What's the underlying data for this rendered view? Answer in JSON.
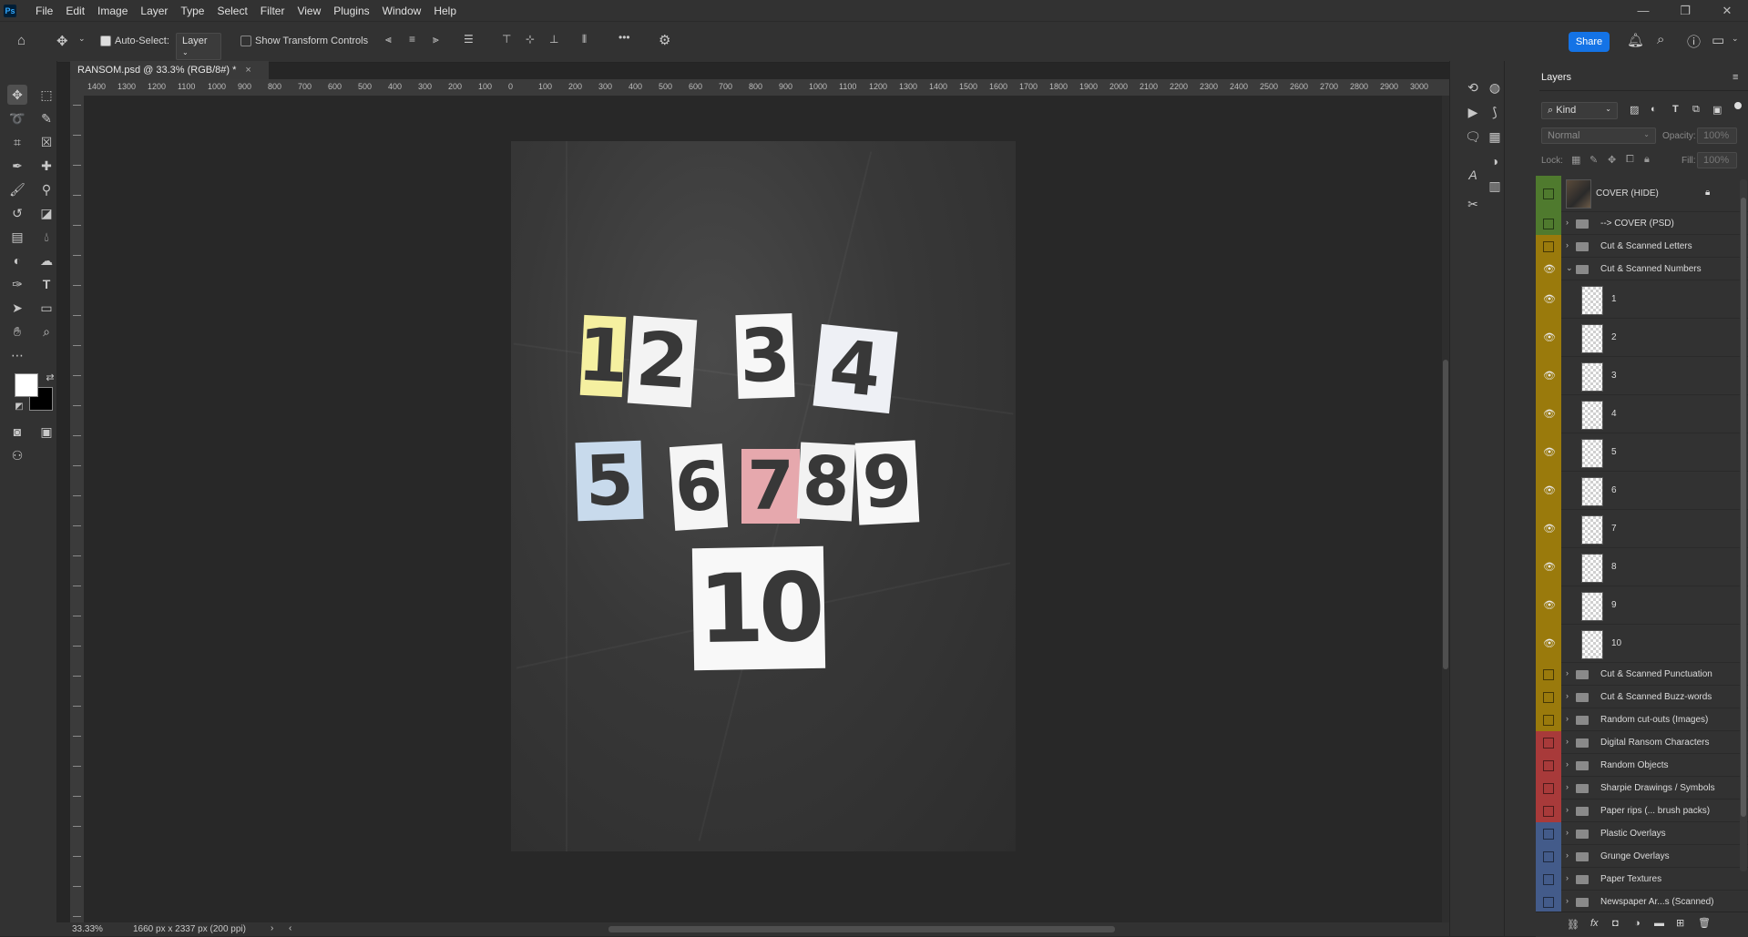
{
  "menu": [
    "File",
    "Edit",
    "Image",
    "Layer",
    "Type",
    "Select",
    "Filter",
    "View",
    "Plugins",
    "Window",
    "Help"
  ],
  "options": {
    "auto_select_label": "Auto-Select:",
    "auto_select_value": "Layer",
    "transform_label": "Show Transform Controls",
    "more": "•••",
    "share": "Share"
  },
  "document": {
    "tab_title": "RANSOM.psd @ 33.3% (RGB/8#) *",
    "close": "×",
    "ruler_labels": [
      "1400",
      "1300",
      "1200",
      "1100",
      "1000",
      "900",
      "800",
      "700",
      "600",
      "500",
      "400",
      "300",
      "200",
      "100",
      "0",
      "100",
      "200",
      "300",
      "400",
      "500",
      "600",
      "700",
      "800",
      "900",
      "1000",
      "1100",
      "1200",
      "1300",
      "1400",
      "1500",
      "1600",
      "1700",
      "1800",
      "1900",
      "2000",
      "2100",
      "2200",
      "2300",
      "2400",
      "2500",
      "2600",
      "2700",
      "2800",
      "2900",
      "3000"
    ],
    "numbers": [
      "1",
      "2",
      "3",
      "4",
      "5",
      "6",
      "7",
      "8",
      "9",
      "10"
    ]
  },
  "status": {
    "zoom": "33.33%",
    "size": "1660 px x 2337 px (200 ppi)"
  },
  "layers_panel": {
    "title": "Layers",
    "filter_kind": "Kind",
    "blend_mode": "Normal",
    "opacity_label": "Opacity:",
    "opacity_value": "100%",
    "lock_label": "Lock:",
    "fill_label": "Fill:",
    "fill_value": "100%",
    "layers": [
      {
        "name": "COVER (HIDE)",
        "type": "image",
        "color": "#4f7a2e",
        "visible": false,
        "locked": true
      },
      {
        "name": "--> COVER (PSD)",
        "type": "group",
        "color": "#4f7a2e",
        "visible": false
      },
      {
        "name": "Cut & Scanned Letters",
        "type": "group",
        "color": "#9a7a0c",
        "visible": false
      },
      {
        "name": "Cut & Scanned Numbers",
        "type": "group-open",
        "color": "#9a7a0c",
        "visible": true
      },
      {
        "name": "1",
        "type": "layer",
        "color": "#9a7a0c",
        "visible": true
      },
      {
        "name": "2",
        "type": "layer",
        "color": "#9a7a0c",
        "visible": true
      },
      {
        "name": "3",
        "type": "layer",
        "color": "#9a7a0c",
        "visible": true
      },
      {
        "name": "4",
        "type": "layer",
        "color": "#9a7a0c",
        "visible": true
      },
      {
        "name": "5",
        "type": "layer",
        "color": "#9a7a0c",
        "visible": true
      },
      {
        "name": "6",
        "type": "layer",
        "color": "#9a7a0c",
        "visible": true
      },
      {
        "name": "7",
        "type": "layer",
        "color": "#9a7a0c",
        "visible": true
      },
      {
        "name": "8",
        "type": "layer",
        "color": "#9a7a0c",
        "visible": true
      },
      {
        "name": "9",
        "type": "layer",
        "color": "#9a7a0c",
        "visible": true
      },
      {
        "name": "10",
        "type": "layer",
        "color": "#9a7a0c",
        "visible": true
      },
      {
        "name": "Cut & Scanned Punctuation",
        "type": "group",
        "color": "#9a7a0c",
        "visible": false
      },
      {
        "name": "Cut & Scanned Buzz-words",
        "type": "group",
        "color": "#9a7a0c",
        "visible": false
      },
      {
        "name": "Random cut-outs (Images)",
        "type": "group",
        "color": "#9a7a0c",
        "visible": false
      },
      {
        "name": "Digital Ransom Characters",
        "type": "group",
        "color": "#a83a3a",
        "visible": false
      },
      {
        "name": "Random Objects",
        "type": "group",
        "color": "#a83a3a",
        "visible": false
      },
      {
        "name": "Sharpie Drawings / Symbols",
        "type": "group",
        "color": "#a83a3a",
        "visible": false
      },
      {
        "name": "Paper rips (... brush packs)",
        "type": "group",
        "color": "#a83a3a",
        "visible": false
      },
      {
        "name": "Plastic Overlays",
        "type": "group",
        "color": "#435b8a",
        "visible": false
      },
      {
        "name": "Grunge Overlays",
        "type": "group",
        "color": "#435b8a",
        "visible": false
      },
      {
        "name": "Paper Textures",
        "type": "group",
        "color": "#435b8a",
        "visible": false
      },
      {
        "name": "Newspaper Ar...s (Scanned)",
        "type": "group",
        "color": "#435b8a",
        "visible": false
      }
    ]
  }
}
